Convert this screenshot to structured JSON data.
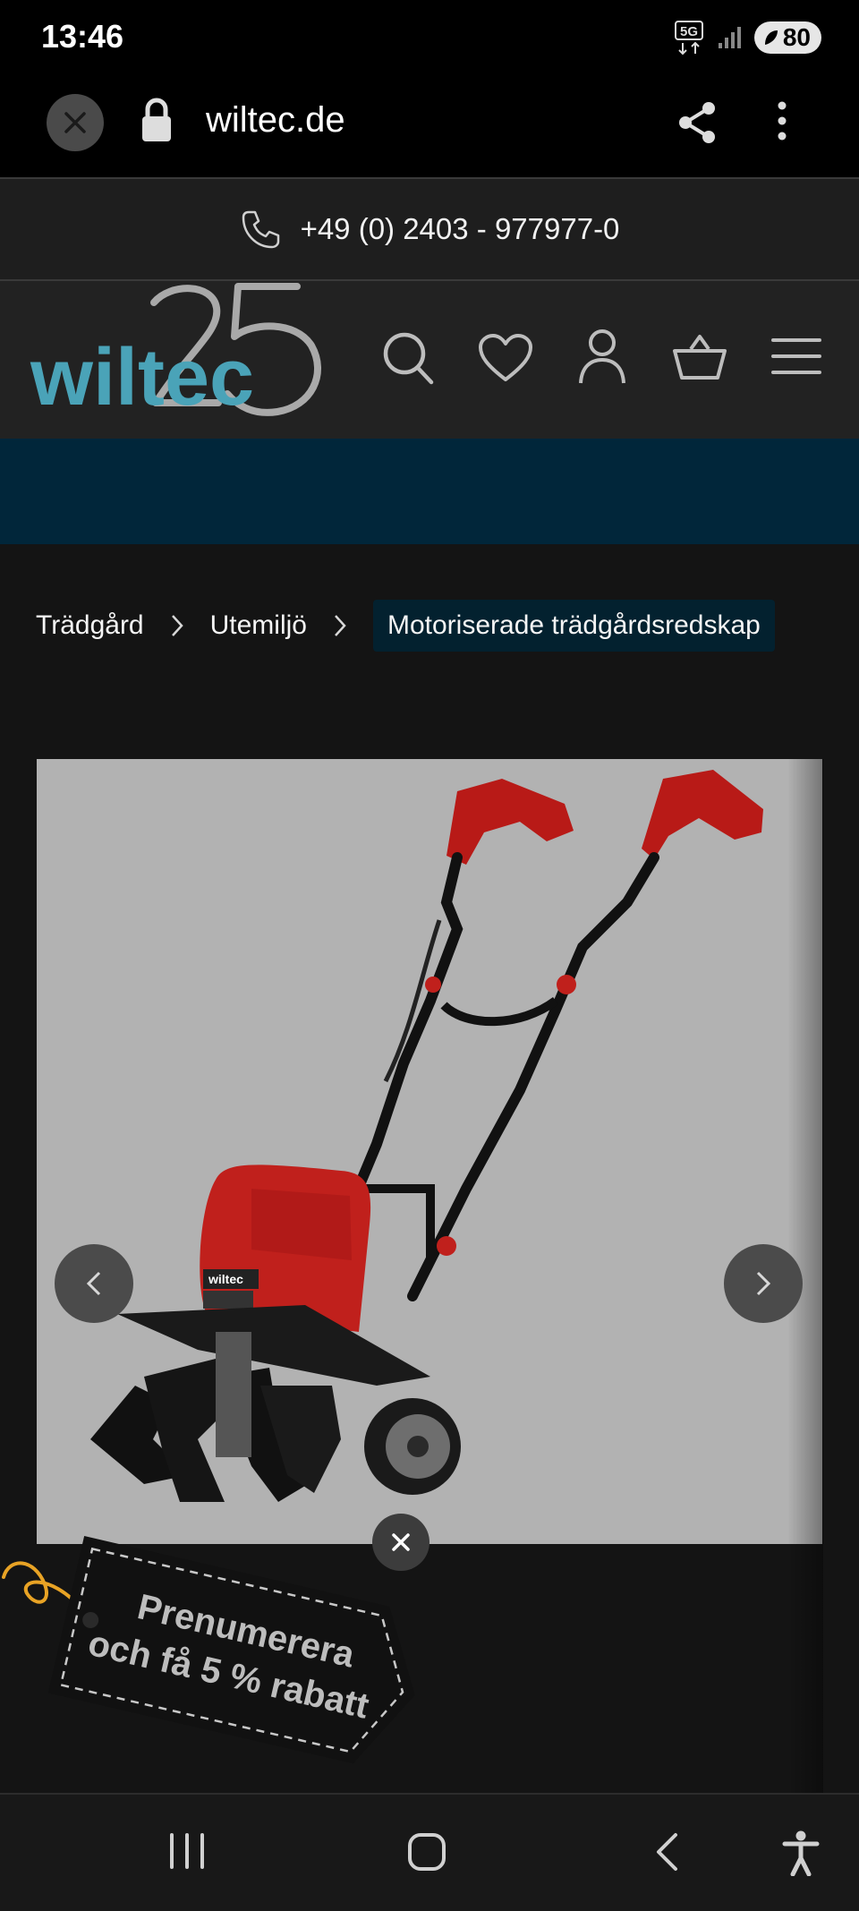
{
  "status_bar": {
    "time": "13:46",
    "network": "5G",
    "battery": "80"
  },
  "browser": {
    "url": "wiltec.de",
    "icons": [
      "close-icon",
      "lock-icon",
      "share-icon",
      "more-vert-icon"
    ]
  },
  "contact": {
    "phone": "+49 (0) 2403 - 977977-0"
  },
  "header": {
    "logo_text": "wiltec",
    "logo_number": "25",
    "icons": [
      "search-icon",
      "heart-icon",
      "user-icon",
      "basket-icon",
      "menu-icon"
    ]
  },
  "breadcrumb": {
    "items": [
      "Trädgård",
      "Utemiljö",
      "Motoriserade trädgårdsredskap"
    ]
  },
  "product_image": {
    "label_on_product": "wiltec"
  },
  "promo": {
    "line1": "Prenumerera",
    "line2": "och få 5 % rabatt"
  },
  "colors": {
    "logo_teal": "#4aa3b8",
    "logo_grey": "#a9a9a9",
    "promo_band": "#01263a",
    "product_red": "#c0201c"
  }
}
